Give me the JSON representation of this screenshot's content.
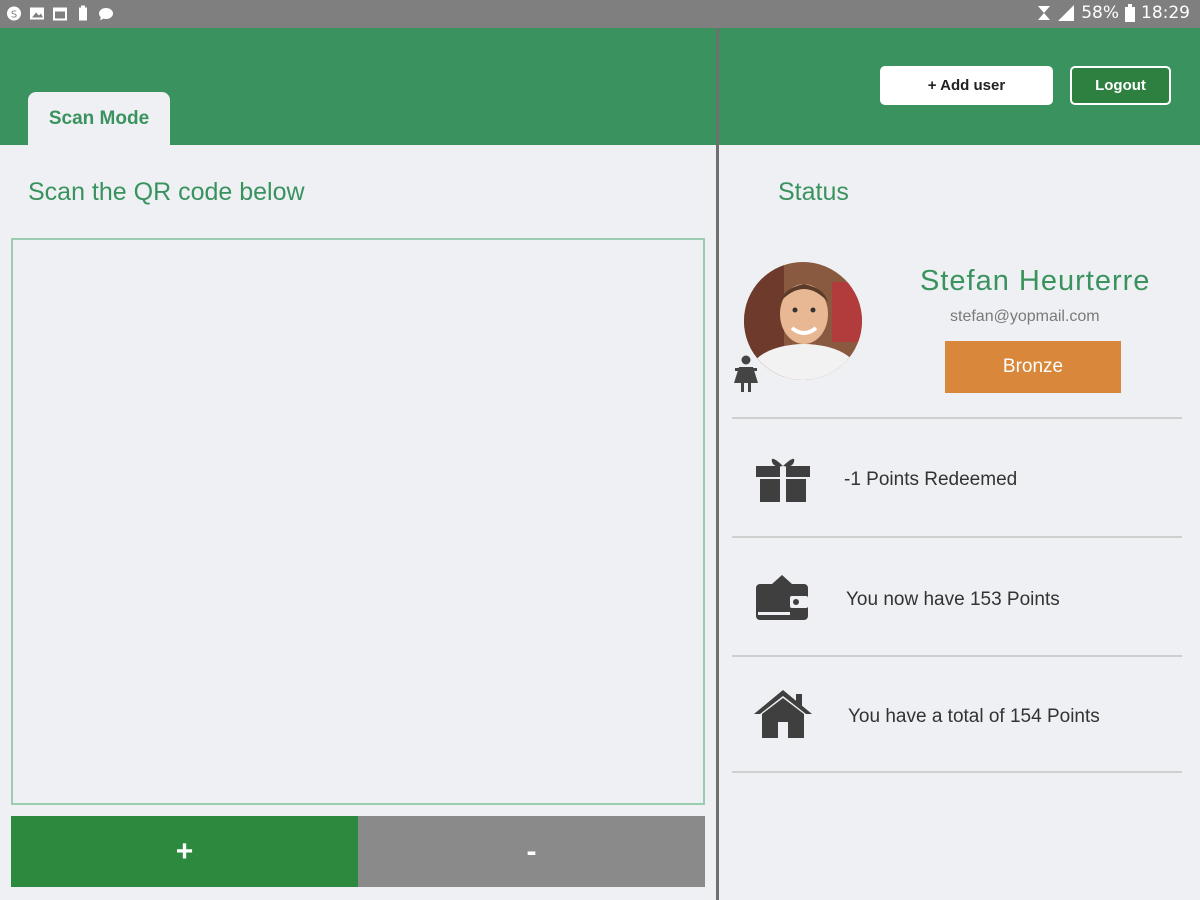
{
  "status_bar": {
    "battery": "58%",
    "time": "18:29"
  },
  "left_panel": {
    "tab_label": "Scan Mode",
    "instruction": "Scan the QR code below",
    "plus_label": "+",
    "minus_label": "-"
  },
  "right_panel": {
    "add_user_label": "+ Add user",
    "logout_label": "Logout",
    "status_title": "Status",
    "user": {
      "name": "Stefan Heurterre",
      "email": "stefan@yopmail.com",
      "tier": "Bronze"
    },
    "rows": [
      {
        "icon": "gift-icon",
        "text": "-1 Points Redeemed"
      },
      {
        "icon": "wallet-icon",
        "text": "You now have 153 Points"
      },
      {
        "icon": "home-icon",
        "text": "You have a total of 154 Points"
      }
    ]
  },
  "colors": {
    "brand_green": "#3a935f",
    "dark_green": "#2c8a3f",
    "gray_button": "#8a8a8a",
    "bronze": "#d9873a"
  }
}
